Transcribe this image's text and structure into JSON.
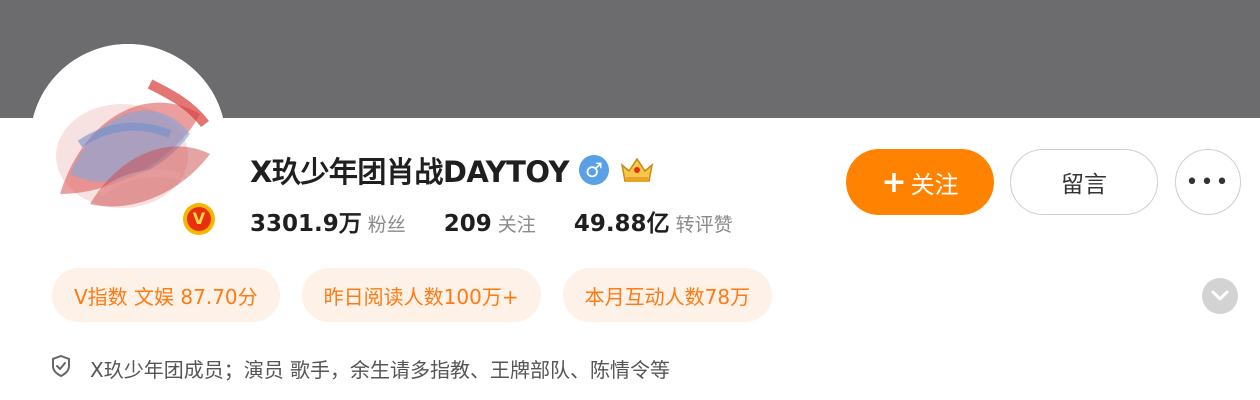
{
  "profile": {
    "name": "X玖少年团肖战DAYTOY",
    "gender_symbol": "♂",
    "verified_badge": "V",
    "stats": [
      {
        "value": "3301.9万",
        "label": "粉丝"
      },
      {
        "value": "209",
        "label": "关注"
      },
      {
        "value": "49.88亿",
        "label": "转评赞"
      }
    ],
    "bio": "X玖少年团成员；演员 歌手，余生请多指教、王牌部队、陈情令等"
  },
  "actions": {
    "follow_plus": "+",
    "follow_label": "关注",
    "message_label": "留言",
    "more_label": "•••"
  },
  "tags": [
    "V指数 文娱 87.70分",
    "昨日阅读人数100万+",
    "本月互动人数78万"
  ],
  "icons": {
    "gender": "male-icon",
    "crown": "crown-badge-icon",
    "verified": "verified-v-icon",
    "expand": "chevron-down-icon",
    "bio": "shield-icon"
  },
  "colors": {
    "cover": "#6c6c6e",
    "accent": "#ff8200",
    "tag_bg": "#fdf1e8",
    "tag_text": "#ff7a12",
    "gender_bg": "#5aa0e6"
  }
}
